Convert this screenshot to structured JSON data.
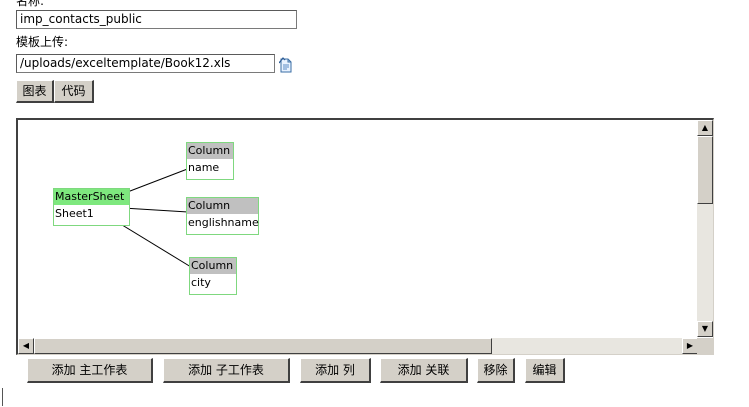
{
  "form": {
    "name_label": "名称:",
    "name_value": "imp_contacts_public",
    "template_label": "模板上传:",
    "template_value": "/uploads/exceltemplate/Book12.xls"
  },
  "tabs": {
    "chart": "图表",
    "code": "代码"
  },
  "diagram": {
    "master": {
      "header": "MasterSheet",
      "body": "Sheet1"
    },
    "columns": [
      {
        "header": "Column",
        "body": "name"
      },
      {
        "header": "Column",
        "body": "englishname"
      },
      {
        "header": "Column",
        "body": "city"
      }
    ]
  },
  "actions": {
    "add_master": "添加 主工作表",
    "add_sub": "添加 子工作表",
    "add_column": "添加 列",
    "add_relation": "添加 关联",
    "remove": "移除",
    "edit": "编辑"
  },
  "colors": {
    "master_header": "#7ee87e",
    "node_border": "#7fd87f",
    "column_header": "#c0c0c0",
    "button_face": "#d4d0c8"
  },
  "icons": {
    "upload": "upload-file-icon"
  }
}
